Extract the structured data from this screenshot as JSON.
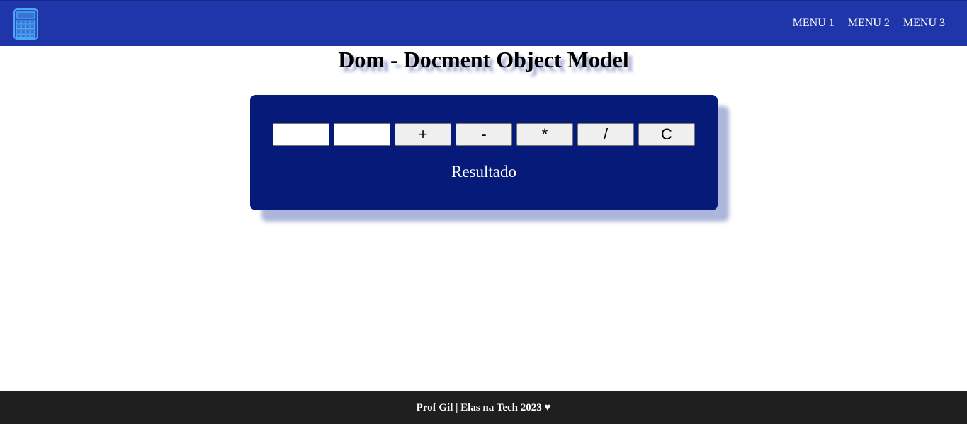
{
  "header": {
    "logo_icon": "calculator-icon",
    "nav": [
      "MENU 1",
      "MENU 2",
      "MENU 3"
    ]
  },
  "page_title": "Dom - Docment Object Model",
  "calculator": {
    "input1_value": "",
    "input2_value": "",
    "buttons": [
      "+",
      "-",
      "*",
      "/",
      "C"
    ],
    "result_label": "Resultado"
  },
  "footer": {
    "text": "Prof Gil | Elas na Tech 2023 ♥"
  },
  "colors": {
    "header_bg": "#1f36ab",
    "calculator_bg": "#061a7a",
    "footer_bg": "#201f1f",
    "logo_accent": "#4aa8f0"
  }
}
